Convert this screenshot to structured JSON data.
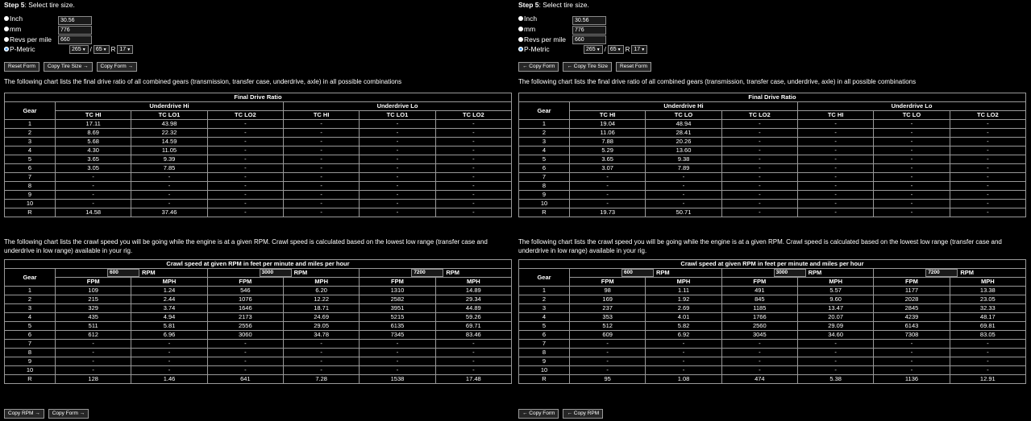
{
  "panels": [
    {
      "step_label": "Step 5",
      "step_text": ": Select tire size.",
      "options": [
        {
          "label": "Inch",
          "value": "30.56",
          "checked": false
        },
        {
          "label": "mm",
          "value": "776",
          "checked": false
        },
        {
          "label": "Revs per mile",
          "value": "660",
          "checked": false
        },
        {
          "label": "P-Metric",
          "value": "",
          "checked": true
        }
      ],
      "pmetric": {
        "width": "265",
        "sep": "/",
        "ratio": "65",
        "r": "R",
        "rim": "17"
      },
      "buttons_top": [
        "Reset Form",
        "Copy Tire Size →",
        "Copy Form →"
      ],
      "ratio_intro": "The following chart lists the final drive ratio of all combined gears (transmission, transfer case, underdrive, axle) in all possible combinations",
      "ratio_table": {
        "title": "Final Drive Ratio",
        "gear_header": "Gear",
        "groups": [
          "Underdrive Hi",
          "Underdrive Lo"
        ],
        "cols": [
          "TC HI",
          "TC LO1",
          "TC LO2",
          "TC HI",
          "TC LO1",
          "TC LO2"
        ],
        "rows": [
          [
            "1",
            "17.11",
            "43.98",
            "-",
            "-",
            "-",
            "-"
          ],
          [
            "2",
            "8.69",
            "22.32",
            "-",
            "-",
            "-",
            "-"
          ],
          [
            "3",
            "5.68",
            "14.59",
            "-",
            "-",
            "-",
            "-"
          ],
          [
            "4",
            "4.30",
            "11.05",
            "-",
            "-",
            "-",
            "-"
          ],
          [
            "5",
            "3.65",
            "9.39",
            "-",
            "-",
            "-",
            "-"
          ],
          [
            "6",
            "3.05",
            "7.85",
            "-",
            "-",
            "-",
            "-"
          ],
          [
            "7",
            "-",
            "-",
            "-",
            "-",
            "-",
            "-"
          ],
          [
            "8",
            "-",
            "-",
            "-",
            "-",
            "-",
            "-"
          ],
          [
            "9",
            "-",
            "-",
            "-",
            "-",
            "-",
            "-"
          ],
          [
            "10",
            "-",
            "-",
            "-",
            "-",
            "-",
            "-"
          ],
          [
            "R",
            "14.58",
            "37.46",
            "-",
            "-",
            "-",
            "-"
          ]
        ]
      },
      "crawl_intro": "The following chart lists the crawl speed you will be going while the engine is at a given RPM. Crawl speed is calculated based on the lowest low range (transfer case and underdrive in low range) available in your rig.",
      "crawl_table": {
        "title": "Crawl speed at given RPM in feet per minute and miles per hour",
        "gear_header": "Gear",
        "rpm_label": "RPM",
        "rpms": [
          "600",
          "3000",
          "7200"
        ],
        "cols": [
          "FPM",
          "MPH",
          "FPM",
          "MPH",
          "FPM",
          "MPH"
        ],
        "rows": [
          [
            "1",
            "109",
            "1.24",
            "546",
            "6.20",
            "1310",
            "14.89"
          ],
          [
            "2",
            "215",
            "2.44",
            "1076",
            "12.22",
            "2582",
            "29.34"
          ],
          [
            "3",
            "329",
            "3.74",
            "1646",
            "18.71",
            "3951",
            "44.89"
          ],
          [
            "4",
            "435",
            "4.94",
            "2173",
            "24.69",
            "5215",
            "59.26"
          ],
          [
            "5",
            "511",
            "5.81",
            "2556",
            "29.05",
            "6135",
            "69.71"
          ],
          [
            "6",
            "612",
            "6.96",
            "3060",
            "34.78",
            "7345",
            "83.46"
          ],
          [
            "7",
            "-",
            "-",
            "-",
            "-",
            "-",
            "-"
          ],
          [
            "8",
            "-",
            "-",
            "-",
            "-",
            "-",
            "-"
          ],
          [
            "9",
            "-",
            "-",
            "-",
            "-",
            "-",
            "-"
          ],
          [
            "10",
            "-",
            "-",
            "-",
            "-",
            "-",
            "-"
          ],
          [
            "R",
            "128",
            "1.46",
            "641",
            "7.28",
            "1538",
            "17.48"
          ]
        ]
      },
      "buttons_bottom": [
        "Copy RPM →",
        "Copy Form →"
      ]
    },
    {
      "step_label": "Step 5",
      "step_text": ": Select tire size.",
      "options": [
        {
          "label": "Inch",
          "value": "30.56",
          "checked": false
        },
        {
          "label": "mm",
          "value": "776",
          "checked": false
        },
        {
          "label": "Revs per mile",
          "value": "660",
          "checked": false
        },
        {
          "label": "P-Metric",
          "value": "",
          "checked": true
        }
      ],
      "pmetric": {
        "width": "265",
        "sep": "/",
        "ratio": "65",
        "r": "R",
        "rim": "17"
      },
      "buttons_top": [
        "← Copy Form",
        "← Copy Tire Size",
        "Reset Form"
      ],
      "ratio_intro": "The following chart lists the final drive ratio of all combined gears (transmission, transfer case, underdrive, axle) in all possible combinations",
      "ratio_table": {
        "title": "Final Drive Ratio",
        "gear_header": "Gear",
        "groups": [
          "Underdrive Hi",
          "Underdrive Lo"
        ],
        "cols": [
          "TC HI",
          "TC LO",
          "TC LO2",
          "TC HI",
          "TC LO",
          "TC LO2"
        ],
        "rows": [
          [
            "1",
            "19.04",
            "48.94",
            "-",
            "-",
            "-",
            "-"
          ],
          [
            "2",
            "11.06",
            "28.41",
            "-",
            "-",
            "-",
            "-"
          ],
          [
            "3",
            "7.88",
            "20.26",
            "-",
            "-",
            "-",
            "-"
          ],
          [
            "4",
            "5.29",
            "13.60",
            "-",
            "-",
            "-",
            "-"
          ],
          [
            "5",
            "3.65",
            "9.38",
            "-",
            "-",
            "-",
            "-"
          ],
          [
            "6",
            "3.07",
            "7.89",
            "-",
            "-",
            "-",
            "-"
          ],
          [
            "7",
            "-",
            "-",
            "-",
            "-",
            "-",
            "-"
          ],
          [
            "8",
            "-",
            "-",
            "-",
            "-",
            "-",
            "-"
          ],
          [
            "9",
            "-",
            "-",
            "-",
            "-",
            "-",
            "-"
          ],
          [
            "10",
            "-",
            "-",
            "-",
            "-",
            "-",
            "-"
          ],
          [
            "R",
            "19.73",
            "50.71",
            "-",
            "-",
            "-",
            "-"
          ]
        ]
      },
      "crawl_intro": "The following chart lists the crawl speed you will be going while the engine is at a given RPM. Crawl speed is calculated based on the lowest low range (transfer case and underdrive in low range) available in your rig.",
      "crawl_table": {
        "title": "Crawl speed at given RPM in feet per minute and miles per hour",
        "gear_header": "Gear",
        "rpm_label": "RPM",
        "rpms": [
          "600",
          "3000",
          "7200"
        ],
        "cols": [
          "FPM",
          "MPH",
          "FPM",
          "MPH",
          "FPM",
          "MPH"
        ],
        "rows": [
          [
            "1",
            "98",
            "1.11",
            "491",
            "5.57",
            "1177",
            "13.38"
          ],
          [
            "2",
            "169",
            "1.92",
            "845",
            "9.60",
            "2028",
            "23.05"
          ],
          [
            "3",
            "237",
            "2.69",
            "1185",
            "13.47",
            "2845",
            "32.33"
          ],
          [
            "4",
            "353",
            "4.01",
            "1766",
            "20.07",
            "4239",
            "48.17"
          ],
          [
            "5",
            "512",
            "5.82",
            "2560",
            "29.09",
            "6143",
            "69.81"
          ],
          [
            "6",
            "609",
            "6.92",
            "3045",
            "34.60",
            "7308",
            "83.05"
          ],
          [
            "7",
            "-",
            "-",
            "-",
            "-",
            "-",
            "-"
          ],
          [
            "8",
            "-",
            "-",
            "-",
            "-",
            "-",
            "-"
          ],
          [
            "9",
            "-",
            "-",
            "-",
            "-",
            "-",
            "-"
          ],
          [
            "10",
            "-",
            "-",
            "-",
            "-",
            "-",
            "-"
          ],
          [
            "R",
            "95",
            "1.08",
            "474",
            "5.38",
            "1136",
            "12.91"
          ]
        ]
      },
      "buttons_bottom": [
        "← Copy Form",
        "← Copy RPM"
      ]
    }
  ]
}
